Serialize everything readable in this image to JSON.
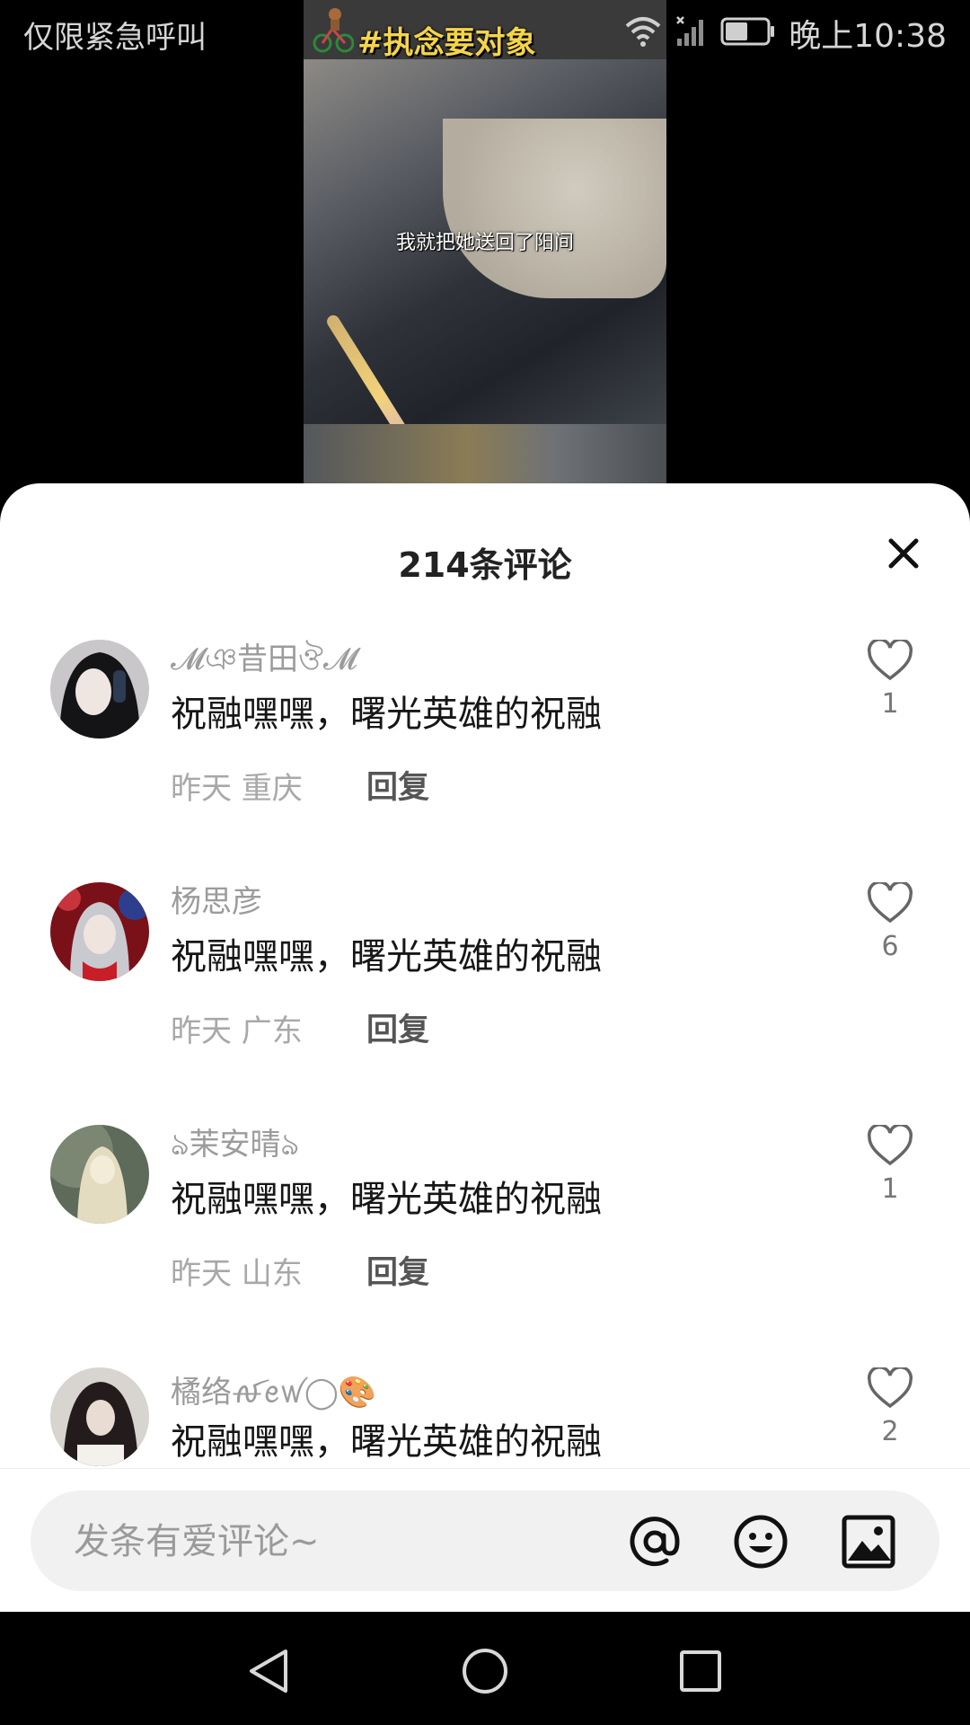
{
  "status_bar": {
    "left_text": "仅限紧急呼叫",
    "time": "晚上10:38",
    "icons": [
      "wifi-icon",
      "signal-icon",
      "battery-icon"
    ]
  },
  "video": {
    "hashtag": "#执念要对象",
    "caption": "我就把她送回了阳间"
  },
  "comments_sheet": {
    "title": "214条评论",
    "close_icon": "close-icon",
    "reply_label": "回复",
    "comments": [
      {
        "username": "𝓜ঞ昔田ঔ𝓜",
        "text": "祝融嘿嘿，曙光英雄的祝融",
        "meta": "昨天  重庆",
        "likes": "1",
        "avatar_color": "#2a2a2e"
      },
      {
        "username": "杨思彦",
        "text": "祝融嘿嘿，曙光英雄的祝融",
        "meta": "昨天  广东",
        "likes": "6",
        "avatar_color": "#b3202a"
      },
      {
        "username": "ঌ茉安晴ঌ",
        "text": "祝融嘿嘿，曙光英雄的祝融",
        "meta": "昨天  山东",
        "likes": "1",
        "avatar_color": "#cfc8a8"
      },
      {
        "username": "橘络ꫛꫀꪝ◯🎨",
        "text": "祝融嘿嘿，曙光英雄的祝融",
        "meta": "",
        "likes": "2",
        "avatar_color": "#3a3030"
      }
    ]
  },
  "input_bar": {
    "placeholder": "发条有爱评论~",
    "icons": [
      "at-icon",
      "emoji-icon",
      "image-icon"
    ]
  },
  "nav_bar": {
    "icons": [
      "back-icon",
      "home-icon",
      "recents-icon"
    ]
  }
}
